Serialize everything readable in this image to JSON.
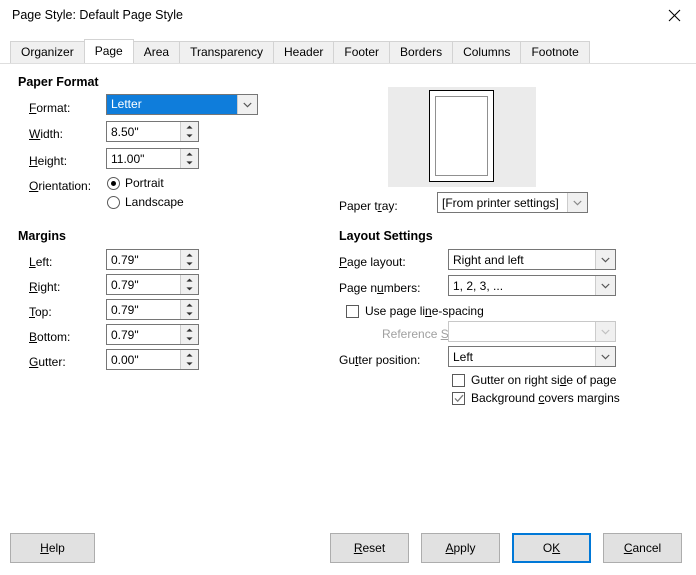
{
  "window": {
    "title": "Page Style: Default Page Style",
    "close_icon": "close-icon"
  },
  "tabs": [
    {
      "label": "Organizer",
      "active": false
    },
    {
      "label": "Page",
      "active": true
    },
    {
      "label": "Area",
      "active": false
    },
    {
      "label": "Transparency",
      "active": false
    },
    {
      "label": "Header",
      "active": false
    },
    {
      "label": "Footer",
      "active": false
    },
    {
      "label": "Borders",
      "active": false
    },
    {
      "label": "Columns",
      "active": false
    },
    {
      "label": "Footnote",
      "active": false
    }
  ],
  "paper_format": {
    "heading": "Paper Format",
    "format_label": "Format:",
    "format_value": "Letter",
    "width_label": "Width:",
    "width_value": "8.50\"",
    "height_label": "Height:",
    "height_value": "11.00\"",
    "orientation_label": "Orientation:",
    "portrait_label": "Portrait",
    "portrait_selected": true,
    "landscape_label": "Landscape",
    "landscape_selected": false
  },
  "preview": {
    "paper_tray_label": "Paper tray:",
    "paper_tray_value": "[From printer settings]"
  },
  "margins": {
    "heading": "Margins",
    "left_label": "Left:",
    "left_value": "0.79\"",
    "right_label": "Right:",
    "right_value": "0.79\"",
    "top_label": "Top:",
    "top_value": "0.79\"",
    "bottom_label": "Bottom:",
    "bottom_value": "0.79\"",
    "gutter_label": "Gutter:",
    "gutter_value": "0.00\""
  },
  "layout_settings": {
    "heading": "Layout Settings",
    "page_layout_label": "Page layout:",
    "page_layout_value": "Right and left",
    "page_numbers_label": "Page numbers:",
    "page_numbers_value": "1, 2, 3, ...",
    "use_line_spacing_label": "Use page line-spacing",
    "use_line_spacing_checked": false,
    "reference_style_label": "Reference Style:",
    "reference_style_value": "",
    "gutter_position_label": "Gutter position:",
    "gutter_position_value": "Left",
    "gutter_right_label": "Gutter on right side of page",
    "gutter_right_checked": false,
    "background_covers_label": "Background covers margins",
    "background_covers_checked": true
  },
  "buttons": {
    "help": "Help",
    "reset": "Reset",
    "apply": "Apply",
    "ok": "OK",
    "cancel": "Cancel"
  },
  "colors": {
    "accent": "#0078d7",
    "selection": "#0f7ddb",
    "panel": "#ffffff",
    "button_face": "#e1e1e1",
    "preview_bg": "#ebebeb"
  }
}
